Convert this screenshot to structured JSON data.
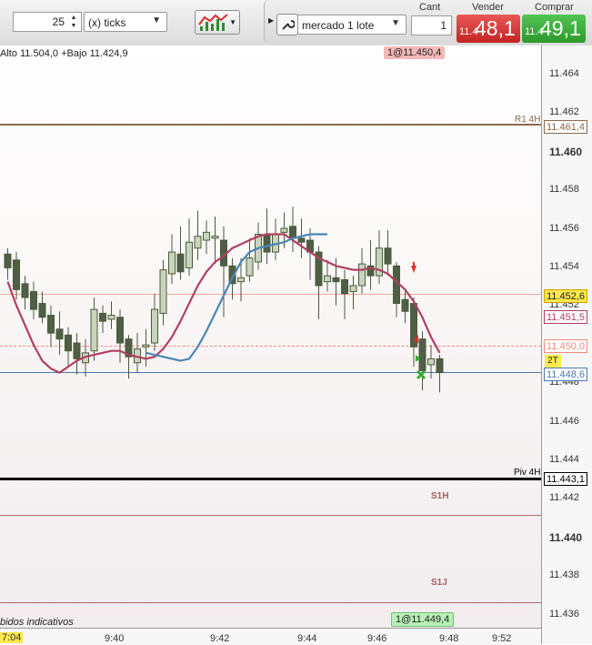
{
  "toolbar": {
    "interval_value": "25",
    "interval_unit": "(x) ticks",
    "order_type": "mercado 1 lote",
    "quantity_label": "Cant",
    "quantity_value": "1",
    "sell_label": "Vender",
    "buy_label": "Comprar",
    "sell_price_prefix": "11.4",
    "sell_price_main": "48,1",
    "buy_price_prefix": "11.4",
    "buy_price_main": "49,1",
    "colors": {
      "sell": "#d33a3a",
      "buy": "#3aad3a"
    }
  },
  "chart": {
    "info_text": "Alto 11.504,0 +Bajo 11.424,9",
    "top_order": "1@11.450,4",
    "bottom_order": "1@11.449,4",
    "footer_text": "bidos indicativos",
    "y_ticks": [
      "11.464",
      "11.462",
      "11.460",
      "11.458",
      "11.456",
      "11.454",
      "11.452",
      "11.450",
      "11.448",
      "11.446",
      "11.444",
      "11.442",
      "11.440",
      "11.438",
      "11.436"
    ],
    "x_ticks": [
      "9:40",
      "9:42",
      "9:44",
      "9:46",
      "9:48",
      "9:52"
    ],
    "first_time": "7:04",
    "levels": {
      "r1": {
        "label": "R1 4H",
        "price": "11.461,4",
        "color": "#8b6a4a"
      },
      "piv": {
        "label": "Piv 4H",
        "price": "11.443,1",
        "color": "#000000"
      },
      "s1h": {
        "label": "S1H"
      },
      "s1j": {
        "label": "S1J"
      }
    },
    "price_tags": {
      "current": "11.452,6",
      "red_ma": "11.451,5",
      "dashed": "11.450,0",
      "blue_ma": "11.448,6",
      "badge": "2T"
    },
    "chart_data": {
      "type": "candlestick",
      "ylim": [
        11.4364,
        11.4654
      ],
      "candles": [
        [
          11.4554,
          11.4547,
          11.4557,
          11.4541
        ],
        [
          11.4551,
          11.4536,
          11.4555,
          11.4531
        ],
        [
          11.4539,
          11.4532,
          11.4543,
          11.4526
        ],
        [
          11.4535,
          11.4526,
          11.454,
          11.4521
        ],
        [
          11.4529,
          11.4522,
          11.4535,
          11.4519
        ],
        [
          11.4523,
          11.4514,
          11.4528,
          11.4507
        ],
        [
          11.4516,
          11.4511,
          11.4525,
          11.4503
        ],
        [
          11.4513,
          11.4505,
          11.4517,
          11.4497
        ],
        [
          11.4509,
          11.4501,
          11.4514,
          11.4493
        ],
        [
          11.4499,
          11.4504,
          11.4511,
          11.4492
        ],
        [
          11.4505,
          11.4526,
          11.4532,
          11.45
        ],
        [
          11.4524,
          11.452,
          11.4528,
          11.4514
        ],
        [
          11.4521,
          11.4523,
          11.453,
          11.4516
        ],
        [
          11.4522,
          11.4509,
          11.4526,
          11.4499
        ],
        [
          11.4511,
          11.4502,
          11.4513,
          11.4491
        ],
        [
          11.4499,
          11.4506,
          11.4514,
          11.4494
        ],
        [
          11.4507,
          11.4508,
          11.4516,
          11.4497
        ],
        [
          11.4509,
          11.4526,
          11.4534,
          11.4505
        ],
        [
          11.4524,
          11.4546,
          11.4551,
          11.4518
        ],
        [
          11.4544,
          11.4555,
          11.4564,
          11.4539
        ],
        [
          11.4554,
          11.4545,
          11.4568,
          11.4541
        ],
        [
          11.4547,
          11.456,
          11.4572,
          11.4543
        ],
        [
          11.4557,
          11.4563,
          11.4576,
          11.4551
        ],
        [
          11.4561,
          11.4565,
          11.4571,
          11.4554
        ],
        [
          11.4562,
          11.4563,
          11.4573,
          11.4549
        ],
        [
          11.4561,
          11.4548,
          11.4568,
          11.4522
        ],
        [
          11.4548,
          11.4539,
          11.4552,
          11.4531
        ],
        [
          11.454,
          11.4542,
          11.4552,
          11.453
        ],
        [
          11.4543,
          11.4552,
          11.4562,
          11.454
        ],
        [
          11.455,
          11.4564,
          11.457,
          11.4546
        ],
        [
          11.4564,
          11.4555,
          11.4577,
          11.4549
        ],
        [
          11.4555,
          11.4564,
          11.4572,
          11.4551
        ],
        [
          11.4565,
          11.4567,
          11.4575,
          11.4557
        ],
        [
          11.4568,
          11.4562,
          11.4578,
          11.4555
        ],
        [
          11.4562,
          11.456,
          11.4572,
          11.4552
        ],
        [
          11.4561,
          11.4555,
          11.4567,
          11.4541
        ],
        [
          11.4555,
          11.4538,
          11.4558,
          11.4521
        ],
        [
          11.454,
          11.4543,
          11.4551,
          11.4535
        ],
        [
          11.4542,
          11.454,
          11.4552,
          11.4528
        ],
        [
          11.4541,
          11.4534,
          11.4546,
          11.4521
        ],
        [
          11.4535,
          11.4538,
          11.4543,
          11.4526
        ],
        [
          11.4538,
          11.4549,
          11.4557,
          11.4534
        ],
        [
          11.4548,
          11.4543,
          11.4561,
          11.4536
        ],
        [
          11.4543,
          11.4557,
          11.4566,
          11.4539
        ],
        [
          11.4557,
          11.4549,
          11.4566,
          11.4543
        ],
        [
          11.4548,
          11.4529,
          11.455,
          11.4522
        ],
        [
          11.4531,
          11.4525,
          11.4535,
          11.4519
        ],
        [
          11.4529,
          11.4507,
          11.4532,
          11.4497
        ],
        [
          11.4511,
          11.4495,
          11.4515,
          11.4485
        ],
        [
          11.4498,
          11.4501,
          11.4508,
          11.4491
        ],
        [
          11.4501,
          11.4494,
          11.4503,
          11.4484
        ]
      ],
      "red_ma": [
        11.454,
        11.4528,
        11.4518,
        11.4508,
        11.45,
        11.4496,
        11.4494,
        11.4497,
        11.45,
        11.4502,
        11.4503,
        11.4504,
        11.4505,
        11.4505,
        11.4503,
        11.4502,
        11.4501,
        11.4502,
        11.4506,
        11.4512,
        11.452,
        11.4529,
        11.4538,
        11.4545,
        11.455,
        11.4553,
        11.4557,
        11.4559,
        11.4561,
        11.4563,
        11.4564,
        11.4564,
        11.4564,
        11.4561,
        11.4558,
        11.4555,
        11.4552,
        11.455,
        11.4548,
        11.4547,
        11.4546,
        11.4546,
        11.4547,
        11.4546,
        11.4544,
        11.454,
        11.4536,
        11.453,
        11.4522,
        11.4512,
        11.4504
      ],
      "blue_ma": [
        11.4504,
        11.4503,
        11.4502,
        11.4501,
        11.45,
        11.4501,
        11.4507,
        11.4515,
        11.4524,
        11.4533,
        11.4542,
        11.455,
        11.4555,
        11.4557,
        11.4558,
        11.4559,
        11.456,
        11.4562,
        11.4563,
        11.4564,
        11.4564,
        11.4564
      ]
    }
  }
}
